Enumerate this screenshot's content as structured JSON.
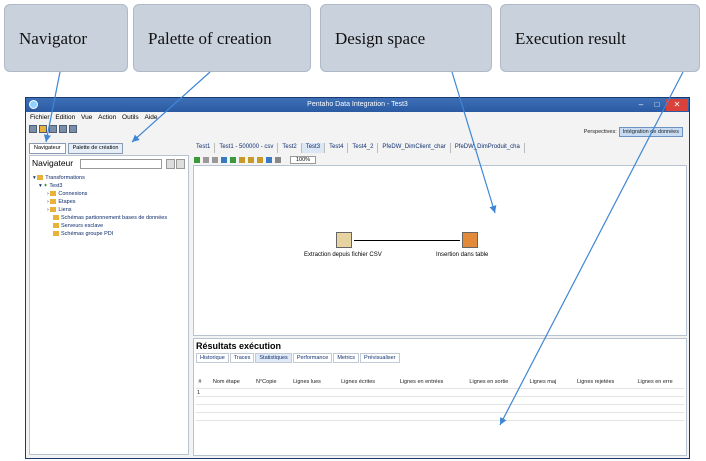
{
  "callouts": [
    "Navigator",
    "Palette of creation",
    "Design space",
    "Execution result"
  ],
  "window": {
    "title": "Pentaho Data Integration - Test3",
    "menu": [
      "Fichier",
      "Edition",
      "Vue",
      "Action",
      "Outils",
      "Aide"
    ]
  },
  "perspectives": {
    "label": "Perspectives:",
    "active": "Intégration de données"
  },
  "left_tabs": [
    "Navigateur",
    "Palette de création"
  ],
  "navigator": {
    "title": "Navigateur",
    "tree": [
      "Transformations",
      "Test3",
      "Connexions",
      "Etapes",
      "Liens",
      "Schémas partionnement bases de données",
      "Serveurs esclave",
      "Schémas groupe PDI"
    ]
  },
  "doc_tabs": [
    "Test1",
    "Test1 - 500000 - csv",
    "Test2",
    "Test3",
    "Test4",
    "Test4_2",
    "PfeDW_DimClient_char",
    "PfeDW_DimProduit_cha"
  ],
  "zoom": "100%",
  "steps": {
    "extract": "Extraction depuis fichier CSV",
    "insert": "Insertion dans table"
  },
  "results": {
    "title": "Résultats exécution",
    "tabs": [
      "Historique",
      "Traces",
      "Statistiques",
      "Performance",
      "Metrics",
      "Prévisualiser"
    ],
    "columns": [
      "#",
      "Nom étape",
      "N°Copie",
      "Lignes lues",
      "Lignes écrites",
      "Lignes en entrées",
      "Lignes en sortie",
      "Lignes maj",
      "Lignes rejetées",
      "Lignes en erre"
    ],
    "rows": [
      "1"
    ]
  },
  "colors": {
    "titlebar": "#2a5aa2",
    "callout": "#c9d1dc",
    "arrow": "#3f86d6",
    "close": "#d9413a"
  }
}
